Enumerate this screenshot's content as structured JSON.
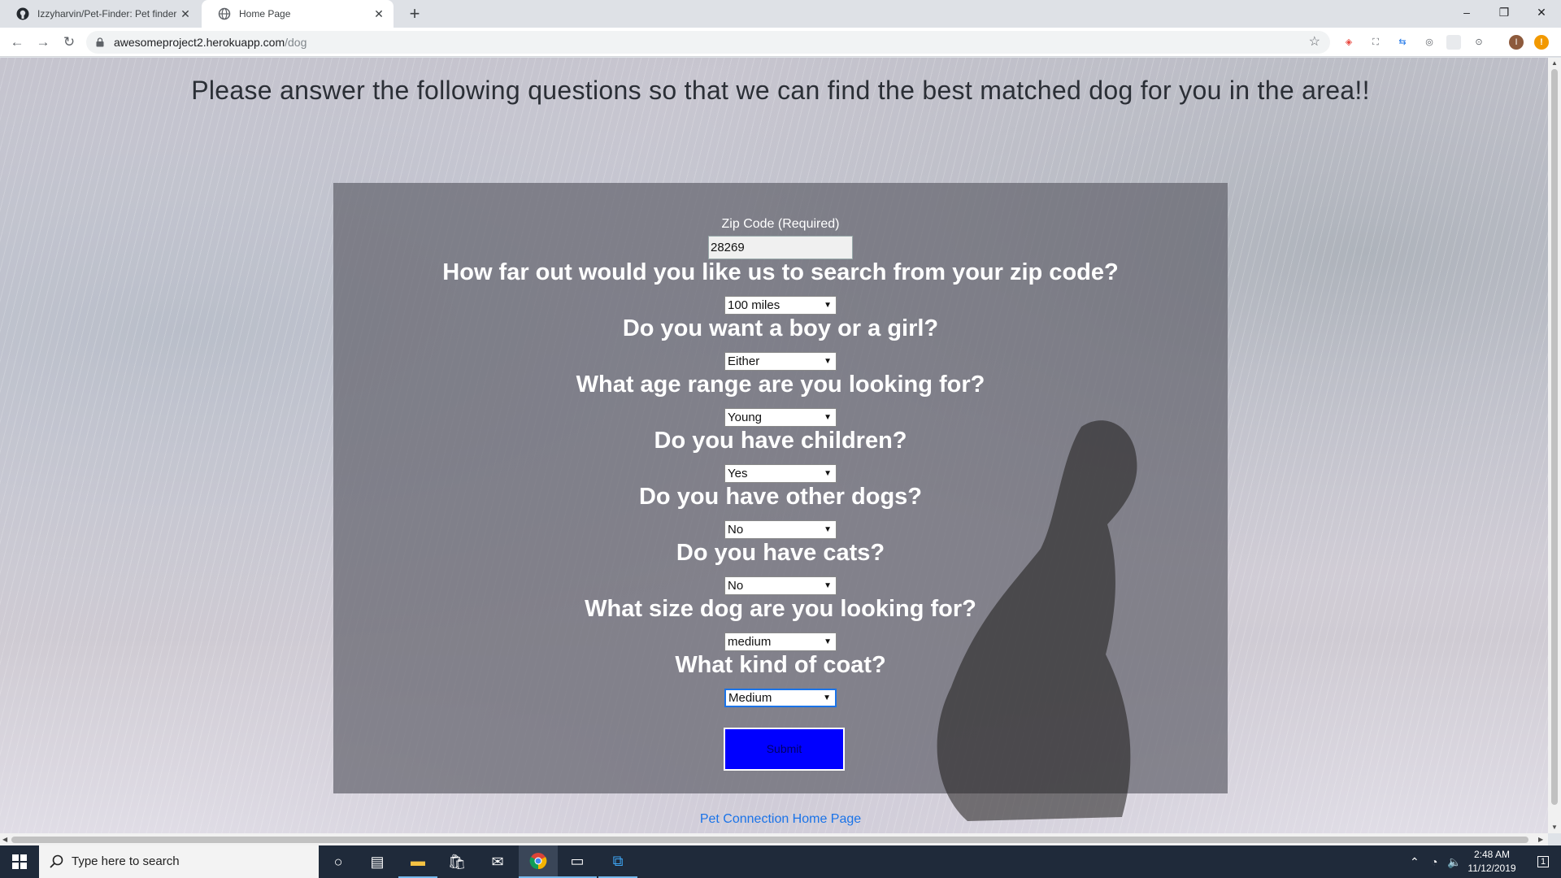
{
  "browser": {
    "tabs": [
      {
        "title": "Izzyharvin/Pet-Finder: Pet finder",
        "active": false,
        "favicon": "github-icon"
      },
      {
        "title": "Home Page",
        "active": true,
        "favicon": "globe-icon"
      }
    ],
    "new_tab": "+",
    "url_host": "awesomeproject2.herokuapp.com",
    "url_path": "/dog",
    "window_controls": {
      "minimize": "–",
      "restore": "❐",
      "close": "✕"
    }
  },
  "page": {
    "heading": "Please answer the following questions so that we can find the best matched dog for you in the area!!",
    "zip": {
      "label": "Zip Code (Required)",
      "value": "28269"
    },
    "questions": [
      {
        "text": "How far out would you like us to search from your zip code?",
        "selected": "100 miles"
      },
      {
        "text": "Do you want a boy or a girl?",
        "selected": "Either"
      },
      {
        "text": "What age range are you looking for?",
        "selected": "Young"
      },
      {
        "text": "Do you have children?",
        "selected": "Yes"
      },
      {
        "text": "Do you have other dogs?",
        "selected": "No"
      },
      {
        "text": "Do you have cats?",
        "selected": "No"
      },
      {
        "text": "What size dog are you looking for?",
        "selected": "medium"
      },
      {
        "text": "What kind of coat?",
        "selected": "Medium"
      }
    ],
    "submit_label": "Submit",
    "home_link": "Pet Connection Home Page"
  },
  "taskbar": {
    "search_placeholder": "Type here to search",
    "time": "2:48 AM",
    "date": "11/12/2019",
    "notification_count": "1"
  },
  "colors": {
    "submit_bg": "#0000ff",
    "link": "#1a73e8",
    "panel": "#64646e"
  }
}
